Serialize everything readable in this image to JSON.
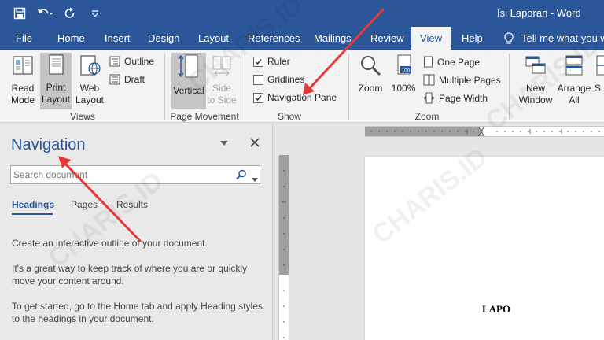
{
  "window": {
    "title": "Isi Laporan  -  Word"
  },
  "quick_access": {
    "icons": [
      "save-icon",
      "undo-icon",
      "redo-icon",
      "customize-icon"
    ]
  },
  "tabs": [
    {
      "label": "File",
      "active": false
    },
    {
      "label": "Home",
      "active": false
    },
    {
      "label": "Insert",
      "active": false
    },
    {
      "label": "Design",
      "active": false
    },
    {
      "label": "Layout",
      "active": false
    },
    {
      "label": "References",
      "active": false
    },
    {
      "label": "Mailings",
      "active": false
    },
    {
      "label": "Review",
      "active": false
    },
    {
      "label": "View",
      "active": true
    },
    {
      "label": "Help",
      "active": false
    }
  ],
  "tell_me": {
    "label": "Tell me what you w",
    "icon": "lightbulb-icon"
  },
  "ribbon": {
    "views": {
      "label": "Views",
      "read_mode": [
        "Read",
        "Mode"
      ],
      "print_layout": [
        "Print",
        "Layout"
      ],
      "web_layout": [
        "Web",
        "Layout"
      ],
      "outline": "Outline",
      "draft": "Draft"
    },
    "page_movement": {
      "label": "Page Movement",
      "vertical": "Vertical",
      "side_to_side": [
        "Side",
        "to Side"
      ]
    },
    "show": {
      "label": "Show",
      "ruler": {
        "label": "Ruler",
        "checked": true
      },
      "gridlines": {
        "label": "Gridlines",
        "checked": false
      },
      "navigation_pane": {
        "label": "Navigation Pane",
        "checked": true
      }
    },
    "zoom": {
      "label": "Zoom",
      "zoom": "Zoom",
      "percent": "100%",
      "percent_icon_text": "100",
      "one_page": "One Page",
      "multiple_pages": "Multiple Pages",
      "page_width": "Page Width"
    },
    "window": {
      "new_window": [
        "New",
        "Window"
      ],
      "arrange_all": [
        "Arrange",
        "All"
      ],
      "split": "S"
    }
  },
  "navigation": {
    "title": "Navigation",
    "search_placeholder": "Search document",
    "tabs": [
      "Headings",
      "Pages",
      "Results"
    ],
    "paragraphs": [
      "Create an interactive outline of your document.",
      "It's a great way to keep track of where you are or quickly move your content around.",
      "To get started, go to the Home tab and apply Heading styles to the headings in your document."
    ]
  },
  "document": {
    "visible_text": "LAPO"
  },
  "watermark": "CHARIS.ID",
  "colors": {
    "accent": "#2b579a",
    "annotation": "#e53935"
  }
}
